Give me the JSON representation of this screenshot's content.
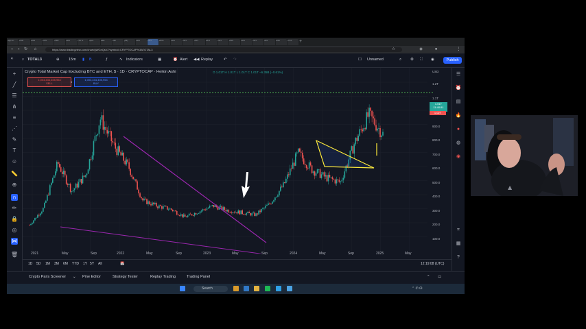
{
  "browser": {
    "tabs": [
      "Sign In",
      "KAD",
      "KAD",
      "KAS",
      "VIRT",
      "Vers",
      "The G",
      "Spot",
      "NEL",
      "Mar",
      "(36)",
      "Vers",
      "Vers",
      "ROC",
      "Vers",
      "Vers",
      "Vers",
      "ATH",
      "Vers",
      "ASC",
      "Vers",
      "Vers",
      "Ses",
      "Sols",
      "Crus"
    ],
    "active_tab_index": 12,
    "url": "https://www.tradingview.com/chart/gWGeQsV/?symbol=CRYPTOCAP%3ATOTAL3"
  },
  "toolbar": {
    "symbol": "TOTAL3",
    "interval": "15m",
    "indicators_label": "Indicators",
    "alert_label": "Alert",
    "replay_label": "Replay",
    "layout_name": "Unnamed",
    "publish_label": "Publish"
  },
  "legend": {
    "title": "Crypto Total Market Cap Excluding BTC and ETH, $ · 1D · CRYPTOCAP · Heikin Ashi",
    "ohlc": "O 1.01T  H 1.01T  L 1.01T  C 1.01T  −6.35B (−0.61%)",
    "sell_price": "1,004,434,405,954",
    "sell_label": "SELL",
    "spread": "0",
    "buy_price": "1,004,434,405,954",
    "buy_label": "BUY"
  },
  "price_scale": {
    "currency": "USD",
    "ticks": [
      "1.2T",
      "1.1T",
      "1.0T",
      "900.0",
      "800.0",
      "700.0",
      "600.0",
      "500.0",
      "400.0",
      "300.0",
      "200.0",
      "100.0"
    ],
    "current_price": "1.01T",
    "current_time": "11:40:51",
    "prev_price": "1.02T"
  },
  "time_scale": {
    "ticks": [
      "2021",
      "May",
      "Sep",
      "2022",
      "May",
      "Sep",
      "2023",
      "May",
      "Sep",
      "2024",
      "May",
      "Sep",
      "2025",
      "May"
    ]
  },
  "ranges": [
    "1D",
    "5D",
    "1M",
    "3M",
    "6M",
    "YTD",
    "1Y",
    "5Y",
    "All"
  ],
  "clock": "12:19:08 (UTC)",
  "bottom_tabs": [
    "Crypto Pairs Screener",
    "Pine Editor",
    "Strategy Tester",
    "Replay Trading",
    "Trading Panel"
  ],
  "taskbar": {
    "search_placeholder": "Search"
  },
  "chart_data": {
    "type": "candlestick",
    "title": "Crypto Total Market Cap Excluding BTC and ETH, $ · 1D · CRYPTOCAP · Heikin Ashi",
    "x": [
      "2021-01",
      "2021-03",
      "2021-05",
      "2021-07",
      "2021-09",
      "2021-11",
      "2022-01",
      "2022-03",
      "2022-05",
      "2022-07",
      "2022-09",
      "2022-11",
      "2023-01",
      "2023-03",
      "2023-05",
      "2023-07",
      "2023-09",
      "2023-11",
      "2024-01",
      "2024-03",
      "2024-05",
      "2024-07",
      "2024-09",
      "2024-11",
      "2024-12",
      "2025-01"
    ],
    "y": [
      200,
      350,
      750,
      500,
      650,
      1150,
      900,
      720,
      420,
      370,
      340,
      270,
      320,
      370,
      330,
      310,
      290,
      390,
      560,
      840,
      690,
      620,
      580,
      930,
      1180,
      1010
    ],
    "y_unit": "USD billions",
    "ylim": [
      0,
      1250
    ],
    "annotations": [
      "purple descending trendline from Nov 2021 peak",
      "purple lower support line",
      "white arrow at May 2023 breakout",
      "yellow triangle pattern 2024",
      "green dotted line near 1.1T"
    ]
  },
  "colors": {
    "up": "#26a69a",
    "down": "#ef5350",
    "trend": "#9c27b0",
    "triangle": "#ffeb3b",
    "accent": "#2962ff",
    "background": "#131722"
  }
}
